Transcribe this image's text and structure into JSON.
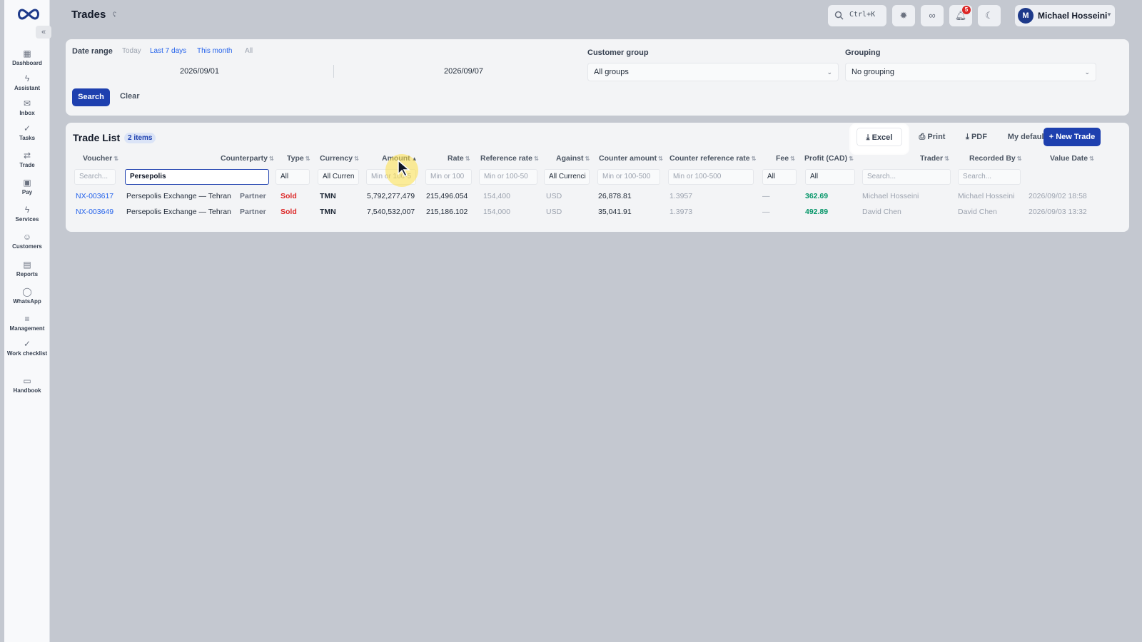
{
  "sidebar": {
    "items": [
      {
        "label": "Dashboard",
        "icon": "grid-icon"
      },
      {
        "label": "Assistant",
        "icon": "bolt-icon"
      },
      {
        "label": "Inbox",
        "icon": "mail-icon"
      },
      {
        "label": "Tasks",
        "icon": "check-icon"
      },
      {
        "label": "Trade",
        "icon": "swap-icon"
      },
      {
        "label": "Pay",
        "icon": "wallet-icon"
      },
      {
        "label": "Services",
        "icon": "bolt-icon"
      },
      {
        "label": "Customers",
        "icon": "users-icon"
      },
      {
        "label": "Reports",
        "icon": "document-icon"
      },
      {
        "label": "WhatsApp",
        "icon": "chat-icon"
      },
      {
        "label": "Management",
        "icon": "sliders-icon"
      },
      {
        "label": "Work checklist",
        "icon": "check-icon"
      },
      {
        "label": "Handbook",
        "icon": "book-icon"
      }
    ],
    "collapse_label": "«"
  },
  "topbar": {
    "title": "Trades",
    "search_shortcut": "Ctrl+K",
    "notification_count": "5",
    "user_initial": "M",
    "user_name": "Michael Hosseini"
  },
  "filters": {
    "date_range_label": "Date range",
    "quick": [
      "Today",
      "Last 7 days",
      "This month",
      "All"
    ],
    "date_from": "2026/09/01",
    "date_to": "2026/09/07",
    "customer_group_label": "Customer group",
    "customer_group_value": "All groups",
    "grouping_label": "Grouping",
    "grouping_value": "No grouping",
    "search_label": "Search",
    "clear_label": "Clear"
  },
  "trade_list": {
    "title": "Trade List",
    "count": "2 items",
    "actions": {
      "excel": "Excel",
      "print": "Print",
      "pdf": "PDF",
      "my_default": "My default",
      "new_trade": "+ New Trade"
    },
    "columns": [
      "Voucher",
      "Counterparty",
      "Type",
      "Currency",
      "Amount",
      "Rate",
      "Reference rate",
      "Against",
      "Counter amount",
      "Counter reference rate",
      "Fee",
      "Profit (CAD)",
      "Trader",
      "Recorded By",
      "Value Date"
    ],
    "column_filters": {
      "voucher": "Search...",
      "counterparty": "Persepolis",
      "type": "All",
      "currency": "All Curren",
      "amount": "Min or 100-5",
      "rate": "Min or 100",
      "reference_rate": "Min or 100-50",
      "against": "All Currenci",
      "counter_amount": "Min or 100-500",
      "counter_reference_rate": "Min or 100-500",
      "fee": "All",
      "profit": "All",
      "trader": "Search...",
      "recorded_by": "Search..."
    },
    "rows": [
      {
        "voucher": "NX-003617",
        "counterparty": "Persepolis Exchange — Tehran",
        "tag": "Partner",
        "type": "Sold",
        "currency": "TMN",
        "amount": "5,792,277,479",
        "rate": "215,496.054",
        "reference_rate": "154,400",
        "against": "USD",
        "counter_amount": "26,878.81",
        "counter_reference_rate": "1.3957",
        "fee": "—",
        "profit": "362.69",
        "trader": "Michael Hosseini",
        "recorded_by": "Michael Hosseini",
        "value_date": "2026/09/02 18:58"
      },
      {
        "voucher": "NX-003649",
        "counterparty": "Persepolis Exchange — Tehran",
        "tag": "Partner",
        "type": "Sold",
        "currency": "TMN",
        "amount": "7,540,532,007",
        "rate": "215,186.102",
        "reference_rate": "154,000",
        "against": "USD",
        "counter_amount": "35,041.91",
        "counter_reference_rate": "1.3973",
        "fee": "—",
        "profit": "492.89",
        "trader": "David Chen",
        "recorded_by": "David Chen",
        "value_date": "2026/09/03 13:32"
      }
    ]
  },
  "colors": {
    "accent": "#1e40af",
    "link": "#2563eb",
    "sold": "#dc2626",
    "profit": "#059669"
  }
}
